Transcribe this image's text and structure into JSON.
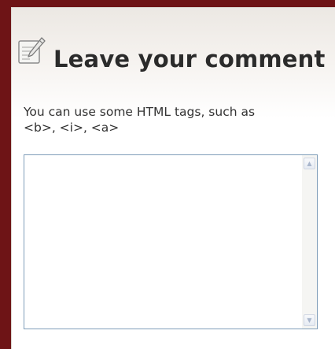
{
  "comment_form": {
    "title": "Leave your comment",
    "icon": "note-pencil-icon",
    "hint_line1": "You can use some HTML tags, such as",
    "hint_line2": "<b>, <i>, <a>",
    "textarea": {
      "value": "",
      "placeholder": ""
    },
    "scrollbar": {
      "up_glyph": "▲",
      "down_glyph": "▼"
    }
  },
  "colors": {
    "frame_border": "#6e1416",
    "heading_text": "#2b2b2b",
    "hint_text": "#333333",
    "field_border": "#7f9db9"
  }
}
